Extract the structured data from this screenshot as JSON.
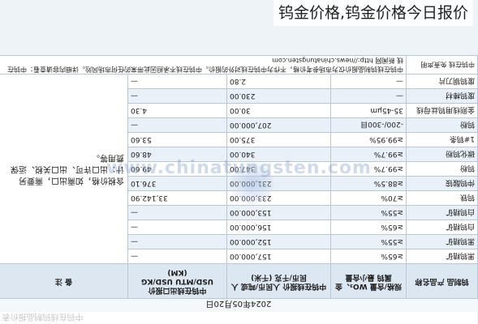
{
  "headline": "钨金价格,钨金价格今日报价",
  "table": {
    "title": "中钨在线钨制品报价表",
    "date": "2024年05月20日",
    "headers": {
      "product": "钨制品 产品名称",
      "spec": "规格/含量 WO₃、金属钨 最小含量",
      "price_cny": "中钨在线报价 人民币/吨或 人民币/千克 (千米)",
      "price_usd": "中钨在线出口报价 USD/MTU USD/KG (KM)",
      "note": "备 注"
    },
    "rows": [
      {
        "product": "黑钨精矿",
        "spec": "≥65%",
        "price_cny": "157,000.00",
        "price_usd": "—"
      },
      {
        "product": "黑钨精矿",
        "spec": "≥55%",
        "price_cny": "152,000.00",
        "price_usd": "—"
      },
      {
        "product": "白钨精矿",
        "spec": "≥65%",
        "price_cny": "156,000.00",
        "price_usd": "—"
      },
      {
        "product": "白钨精矿",
        "spec": "≥55%",
        "price_cny": "153,000.00",
        "price_usd": "—"
      },
      {
        "product": "钨铁",
        "spec": "≥70%",
        "price_cny": "233,000.00",
        "price_usd": "33,142.90"
      },
      {
        "product": "仲钨酸铵",
        "spec": "≥88.5%",
        "price_cny": "231,000.00",
        "price_usd": "376.10"
      },
      {
        "product": "钨粉",
        "spec": "≥99.7%",
        "price_cny": "347.00",
        "price_usd": "49.60"
      },
      {
        "product": "碳化钨粉",
        "spec": "≥99.7%",
        "price_cny": "340.00",
        "price_usd": "48.60"
      },
      {
        "product": "1#钨条",
        "spec": "≥99.95%",
        "price_cny": "375.00",
        "price_usd": "53.60"
      },
      {
        "product": "钨粉",
        "spec": "-200/-300目",
        "price_cny": "207,000.00",
        "price_usd": "—"
      },
      {
        "product": "金刚线用钨丝母线",
        "spec": "35-45μm",
        "price_cny": "30.00",
        "price_usd": "4.30"
      },
      {
        "product": "废钨棒材",
        "spec": "—",
        "price_cny": "230.00",
        "price_usd": "—"
      },
      {
        "product": "废钨钢刀片",
        "spec": "—",
        "price_cny": "2.80",
        "price_usd": "—"
      }
    ],
    "note": "含税价格，如需出口，需要另计：出口许可、出口关税、运保费用等。",
    "footnote_label": "中钨在线 免责声明",
    "footnote_text": "中钨在线钨制品报价仅为市场参考价格，不作为中钨在线对外的报价。中钨在线不承担因此带来的任何市场风险。详细内容请查看：中钨在线 新闻网 http://news.chinatungsten.com"
  },
  "watermark": "www.chinatungsten.com"
}
